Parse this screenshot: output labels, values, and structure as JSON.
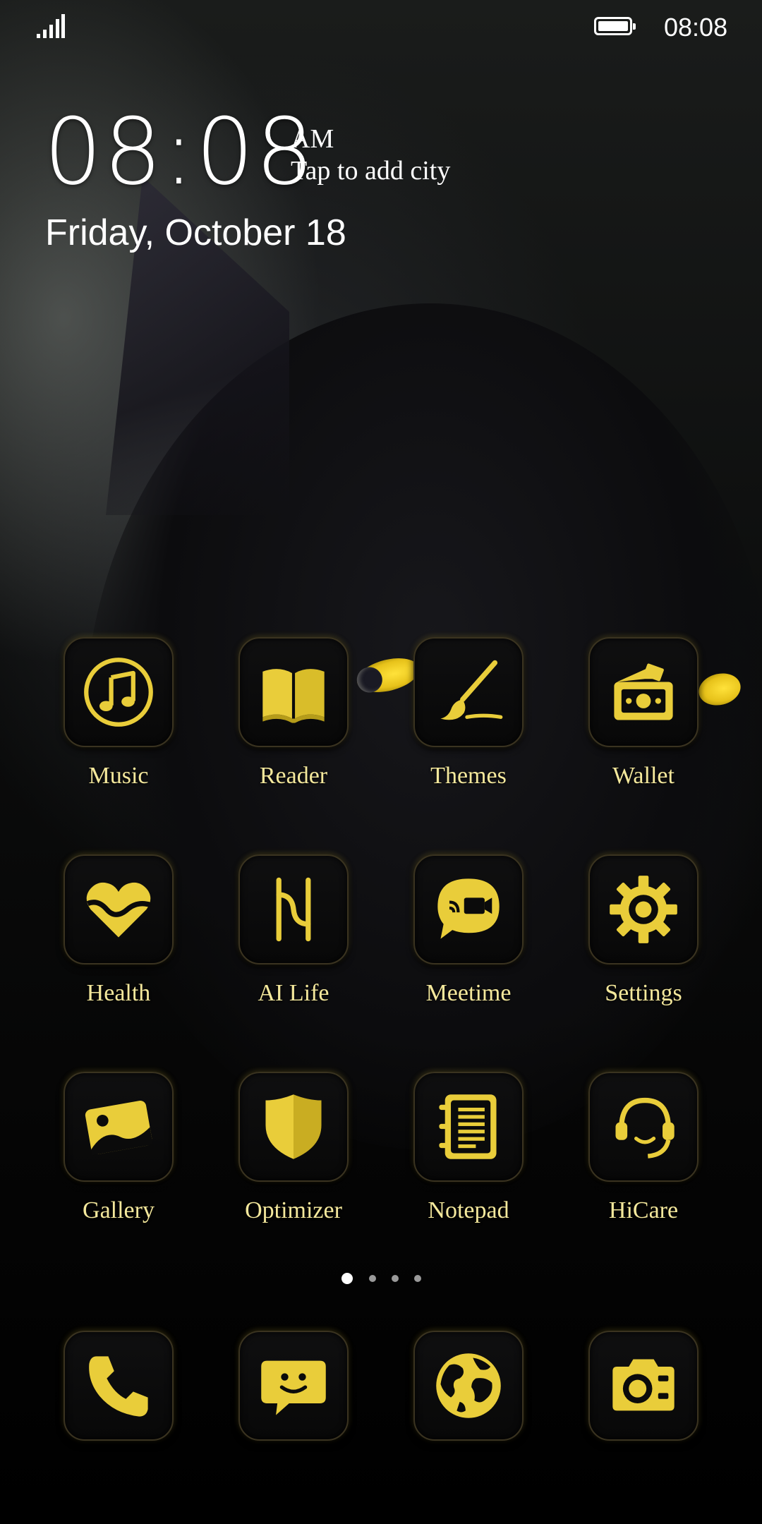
{
  "status_bar": {
    "time": "08:08",
    "signal_icon": "signal-icon",
    "battery_icon": "battery-icon"
  },
  "clock": {
    "time": "08:08",
    "ampm": "AM",
    "city_prompt": "Tap to add city",
    "date": "Friday, October 18"
  },
  "apps": [
    {
      "label": "Music",
      "icon": "music-icon"
    },
    {
      "label": "Reader",
      "icon": "book-icon"
    },
    {
      "label": "Themes",
      "icon": "paintbrush-icon"
    },
    {
      "label": "Wallet",
      "icon": "wallet-icon"
    },
    {
      "label": "Health",
      "icon": "heart-icon"
    },
    {
      "label": "AI Life",
      "icon": "ai-life-icon"
    },
    {
      "label": "Meetime",
      "icon": "video-chat-icon"
    },
    {
      "label": "Settings",
      "icon": "gear-icon"
    },
    {
      "label": "Gallery",
      "icon": "photo-icon"
    },
    {
      "label": "Optimizer",
      "icon": "shield-icon"
    },
    {
      "label": "Notepad",
      "icon": "notepad-icon"
    },
    {
      "label": "HiCare",
      "icon": "headset-icon"
    }
  ],
  "page_indicator": {
    "pages": 4,
    "active": 1
  },
  "dock": [
    {
      "icon": "phone-icon"
    },
    {
      "icon": "message-icon"
    },
    {
      "icon": "globe-icon"
    },
    {
      "icon": "camera-icon"
    }
  ],
  "colors": {
    "icon_gold": "#e9cd3a",
    "label_gold": "#f4e89c",
    "background": "#050505"
  }
}
